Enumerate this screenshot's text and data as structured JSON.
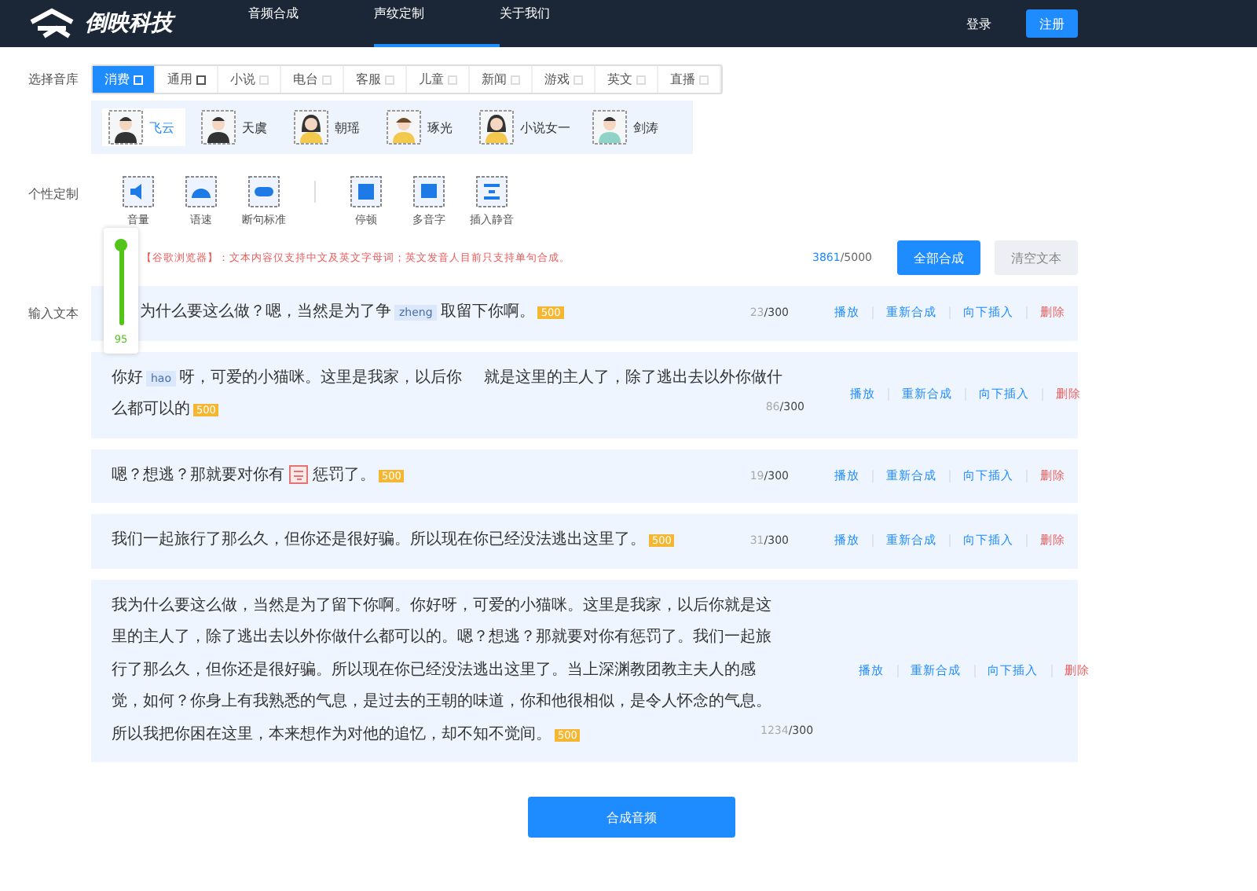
{
  "header": {
    "brand": "倒映科技",
    "nav": [
      {
        "label": "音频合成",
        "selected": false
      },
      {
        "label": "声纹定制",
        "selected": true
      },
      {
        "label": "关于我们",
        "selected": false
      }
    ],
    "login": "登录",
    "register": "注册"
  },
  "library": {
    "label": "选择音库",
    "tabs": [
      {
        "label": "消费",
        "selected": true,
        "marked": true
      },
      {
        "label": "通用",
        "selected": false,
        "marked": true
      },
      {
        "label": "小说",
        "selected": false,
        "marked": false
      },
      {
        "label": "电台",
        "selected": false,
        "marked": false
      },
      {
        "label": "客服",
        "selected": false,
        "marked": false
      },
      {
        "label": "儿童",
        "selected": false,
        "marked": false
      },
      {
        "label": "新闻",
        "selected": false,
        "marked": false
      },
      {
        "label": "游戏",
        "selected": false,
        "marked": false
      },
      {
        "label": "英文",
        "selected": false,
        "marked": false
      },
      {
        "label": "直播",
        "selected": false,
        "marked": false
      }
    ],
    "voices": [
      {
        "name": "飞云",
        "selected": true,
        "kind": "man"
      },
      {
        "name": "天虞",
        "selected": false,
        "kind": "man"
      },
      {
        "name": "朝瑶",
        "selected": false,
        "kind": "woman"
      },
      {
        "name": "琢光",
        "selected": false,
        "kind": "girl"
      },
      {
        "name": "小说女一",
        "selected": false,
        "kind": "woman"
      },
      {
        "name": "剑涛",
        "selected": false,
        "kind": "boy"
      }
    ]
  },
  "custom": {
    "label": "个性定制",
    "tools": [
      {
        "label": "音量",
        "kind": "volume"
      },
      {
        "label": "语速",
        "kind": "speed"
      },
      {
        "label": "断句标准",
        "kind": "break"
      },
      {
        "label": "停顿",
        "kind": "pause"
      },
      {
        "label": "多音字",
        "kind": "poly"
      },
      {
        "label": "插入静音",
        "kind": "silence"
      }
    ],
    "volume": {
      "level": 0.95,
      "reading": "95"
    }
  },
  "notice": "【谷歌浏览器】：文本内容仅支持中文及英文字母词；英文发音人目前只支持单句合成。",
  "counter": {
    "used": "3861",
    "max": "/5000"
  },
  "synth_all": "全部合成",
  "clear": "清空文本",
  "input_label": "输入文本",
  "segments": [
    {
      "lines": [
        [
          {
            "kind": "text",
            "text": "为什么要这么做？嗯，当然是为了争"
          },
          {
            "kind": "pinyin",
            "text": "zheng"
          },
          {
            "kind": "text",
            "text": "取留下你啊。"
          },
          {
            "kind": "badge",
            "text": "500"
          }
        ]
      ],
      "count": "23",
      "limit": "/300",
      "actions": [
        {
          "label": "播放",
          "kind": "normal"
        },
        {
          "label": "重新合成",
          "kind": "normal"
        },
        {
          "label": "向下插入",
          "kind": "normal"
        },
        {
          "label": "删除",
          "kind": "danger"
        }
      ]
    },
    {
      "lines": [
        [
          {
            "kind": "text",
            "text": "你好"
          },
          {
            "kind": "pinyin",
            "text": "hao"
          },
          {
            "kind": "text",
            "text": "呀，可爱的小猫咪。这里是我家，以后你"
          },
          {
            "kind": "gap"
          },
          {
            "kind": "text",
            "text": "就是这里的主人了，除了逃出去以外你做什"
          }
        ],
        [
          {
            "kind": "text",
            "text": "么都可以的"
          },
          {
            "kind": "badge",
            "text": "500"
          }
        ]
      ],
      "count": "86",
      "limit": "/300",
      "actions": [
        {
          "label": "播放",
          "kind": "normal"
        },
        {
          "label": "重新合成",
          "kind": "normal"
        },
        {
          "label": "向下插入",
          "kind": "normal"
        },
        {
          "label": "删除",
          "kind": "danger"
        }
      ]
    },
    {
      "lines": [
        [
          {
            "kind": "text",
            "text": "嗯？想逃？那就要对你有"
          },
          {
            "kind": "mark"
          },
          {
            "kind": "text",
            "text": "惩罚了。"
          },
          {
            "kind": "badge",
            "text": "500"
          }
        ]
      ],
      "count": "19",
      "limit": "/300",
      "actions": [
        {
          "label": "播放",
          "kind": "normal"
        },
        {
          "label": "重新合成",
          "kind": "normal"
        },
        {
          "label": "向下插入",
          "kind": "normal"
        },
        {
          "label": "删除",
          "kind": "danger"
        }
      ]
    },
    {
      "lines": [
        [
          {
            "kind": "text",
            "text": "我们一起旅行了那么久，但你还是很好骗。所以现在你已经没法逃出这里了。"
          },
          {
            "kind": "badge",
            "text": "500"
          }
        ]
      ],
      "count": "31",
      "limit": "/300",
      "actions": [
        {
          "label": "播放",
          "kind": "normal"
        },
        {
          "label": "重新合成",
          "kind": "normal"
        },
        {
          "label": "向下插入",
          "kind": "normal"
        },
        {
          "label": "删除",
          "kind": "danger"
        }
      ]
    },
    {
      "lines": [
        [
          {
            "kind": "text",
            "text": "我为什么要这么做，当然是为了留下你啊。你好呀，可爱的小猫咪。这里是我家，以后你就是这"
          }
        ],
        [
          {
            "kind": "text",
            "text": "里的主人了，除了逃出去以外你做什么都可以的。嗯？想逃？那就要对你有惩罚了。我们一起旅"
          }
        ],
        [
          {
            "kind": "text",
            "text": "行了那么久，但你还是很好骗。所以现在你已经没法逃出这里了。当上深渊教团教主夫人的感"
          }
        ],
        [
          {
            "kind": "text",
            "text": "觉，如何？你身上有我熟悉的气息，是过去的王朝的味道，你和他很相似，是令人怀念的气息。"
          }
        ],
        [
          {
            "kind": "text",
            "text": "所以我把你困在这里，本来想作为对他的追忆，却不知不觉间。"
          },
          {
            "kind": "badge",
            "text": "500"
          }
        ]
      ],
      "count": "1234",
      "limit": "/300",
      "actions": [
        {
          "label": "播放",
          "kind": "normal"
        },
        {
          "label": "重新合成",
          "kind": "normal"
        },
        {
          "label": "向下插入",
          "kind": "normal"
        },
        {
          "label": "删除",
          "kind": "danger"
        }
      ]
    }
  ],
  "submit": "合成音频"
}
